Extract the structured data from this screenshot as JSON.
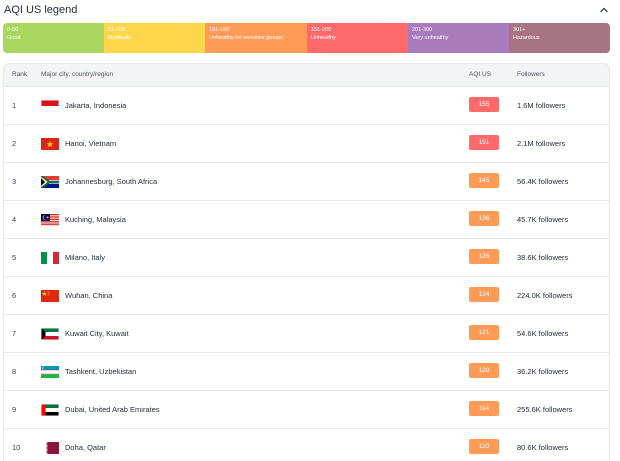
{
  "legend": {
    "title": "AQI US legend",
    "segments": [
      {
        "range": "0-50",
        "label": "Good",
        "color": "#a8d65e"
      },
      {
        "range": "51-100",
        "label": "Moderate",
        "color": "#fdd64b"
      },
      {
        "range": "101-150",
        "label": "Unhealthy for sensitive groups",
        "color": "#ff9b57"
      },
      {
        "range": "151-200",
        "label": "Unhealthy",
        "color": "#fe6a69"
      },
      {
        "range": "201-300",
        "label": "Very unhealthy",
        "color": "#a97abc"
      },
      {
        "range": "301+",
        "label": "Hazardous",
        "color": "#a87383"
      }
    ]
  },
  "table": {
    "headers": {
      "rank": "Rank",
      "city": "Major city, country/region",
      "aqi": "AQI US",
      "followers": "Followers"
    },
    "rows": [
      {
        "rank": "1",
        "city": "Jakarta, Indonesia",
        "flag": "indonesia-flag-icon",
        "aqi": "155",
        "aqi_color": "#fe6a69",
        "followers": "1.6M followers"
      },
      {
        "rank": "2",
        "city": "Hanoi, Vietnam",
        "flag": "vietnam-flag-icon",
        "aqi": "151",
        "aqi_color": "#fe6a69",
        "followers": "2.1M followers"
      },
      {
        "rank": "3",
        "city": "Johannesburg, South Africa",
        "flag": "south-africa-flag-icon",
        "aqi": "145",
        "aqi_color": "#ff9b57",
        "followers": "56.4K followers"
      },
      {
        "rank": "4",
        "city": "Kuching, Malaysia",
        "flag": "malaysia-flag-icon",
        "aqi": "136",
        "aqi_color": "#ff9b57",
        "followers": "45.7K followers"
      },
      {
        "rank": "5",
        "city": "Milano, Italy",
        "flag": "italy-flag-icon",
        "aqi": "126",
        "aqi_color": "#ff9b57",
        "followers": "38.6K followers"
      },
      {
        "rank": "6",
        "city": "Wuhan, China",
        "flag": "china-flag-icon",
        "aqi": "124",
        "aqi_color": "#ff9b57",
        "followers": "224.0K followers"
      },
      {
        "rank": "7",
        "city": "Kuwait City, Kuwait",
        "flag": "kuwait-flag-icon",
        "aqi": "121",
        "aqi_color": "#ff9b57",
        "followers": "54.6K followers"
      },
      {
        "rank": "8",
        "city": "Tashkent, Uzbekistan",
        "flag": "uzbekistan-flag-icon",
        "aqi": "120",
        "aqi_color": "#ff9b57",
        "followers": "36.2K followers"
      },
      {
        "rank": "9",
        "city": "Dubai, United Arab Emirates",
        "flag": "uae-flag-icon",
        "aqi": "114",
        "aqi_color": "#ff9b57",
        "followers": "255.6K followers"
      },
      {
        "rank": "10",
        "city": "Doha, Qatar",
        "flag": "qatar-flag-icon",
        "aqi": "110",
        "aqi_color": "#ff9b57",
        "followers": "80.6K followers"
      }
    ]
  }
}
